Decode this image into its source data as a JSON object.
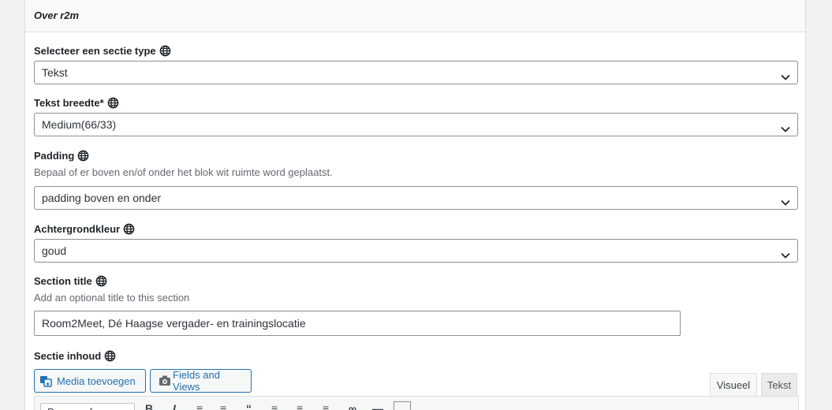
{
  "panel": {
    "title": "Over r2m"
  },
  "fields": {
    "section_type": {
      "label": "Selecteer een sectie type",
      "value": "Tekst"
    },
    "text_width": {
      "label": "Tekst breedte*",
      "value": "Medium(66/33)"
    },
    "padding": {
      "label": "Padding",
      "description": "Bepaal of er boven en/of onder het blok wit ruimte word geplaatst.",
      "value": "padding boven en onder"
    },
    "background": {
      "label": "Achtergrondkleur",
      "value": "goud"
    },
    "section_title": {
      "label": "Section title",
      "description": "Add an optional title to this section",
      "value": "Room2Meet, Dé Haagse vergader- en trainingslocatie"
    },
    "section_content": {
      "label": "Sectie inhoud"
    }
  },
  "editor": {
    "media_button": "Media toevoegen",
    "fields_views_button": "Fields and Views",
    "tab_visual": "Visueel",
    "tab_text": "Tekst",
    "format_select": "Paragraaf"
  },
  "colors": {
    "accent": "#2271b1",
    "border": "#8c8f94"
  },
  "icons": [
    "globe-icon",
    "chevron-down-icon",
    "media-icon",
    "fields-views-icon"
  ]
}
